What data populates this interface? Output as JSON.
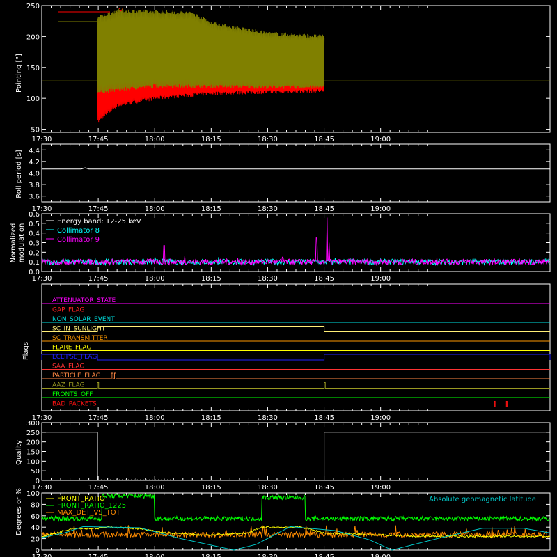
{
  "colors": {
    "background": "#000000",
    "axes": "#ffffff",
    "x_pointing": "#ff0000",
    "y_pointing": "#808000",
    "collimator_8": "#00ffff",
    "collimator_9": "#ff00ff",
    "front_ratio": "#ffff00",
    "front_ratio_1225": "#00ff00",
    "max_det_vs_tot": "#ff8c00",
    "geomag_latitude": "#00c8c8"
  },
  "chart_data": [
    {
      "type": "line",
      "panel": "pointing",
      "ylabel": "Pointing [\"]",
      "ylim": [
        45,
        250
      ],
      "yticks": [
        50,
        100,
        150,
        200,
        250
      ],
      "xlim": [
        1050,
        1185
      ],
      "xticks": [
        1050,
        1065,
        1080,
        1095,
        1110,
        1125,
        1140
      ],
      "xticklabels": [
        "17:30",
        "17:45",
        "18:00",
        "18:15",
        "18:30",
        "18:45",
        "19:00"
      ],
      "legend": [
        "X",
        "Y"
      ],
      "legend_placement": "top-left",
      "series": [
        {
          "name": "X",
          "baseline": 128,
          "active_range": [
            1064.8,
            1125
          ],
          "envelope_low": [
            [
              1064.8,
              62
            ],
            [
              1070,
              88
            ],
            [
              1080,
              100
            ],
            [
              1095,
              108
            ],
            [
              1110,
              110
            ],
            [
              1125,
              112
            ]
          ],
          "envelope_high": [
            [
              1064.8,
              160
            ],
            [
              1080,
              140
            ],
            [
              1110,
              130
            ],
            [
              1125,
              128
            ]
          ]
        },
        {
          "name": "Y",
          "baseline": 128,
          "active_range": [
            1064.8,
            1125
          ],
          "envelope_low": [
            [
              1064.8,
              110
            ],
            [
              1080,
              120
            ],
            [
              1110,
              118
            ],
            [
              1125,
              118
            ]
          ],
          "envelope_high": [
            [
              1064.8,
              230
            ],
            [
              1070,
              242
            ],
            [
              1080,
              240
            ],
            [
              1090,
              238
            ],
            [
              1095,
              222
            ],
            [
              1110,
              205
            ],
            [
              1125,
              200
            ]
          ]
        }
      ]
    },
    {
      "type": "line",
      "panel": "roll",
      "ylabel": "Roll period [s]",
      "ylim": [
        3.5,
        4.5
      ],
      "yticks": [
        3.6,
        3.8,
        4.0,
        4.2,
        4.4
      ],
      "yticklabels": [
        "3.6",
        "3.8",
        "4.0",
        "4.2",
        "4.4"
      ],
      "x": [
        1050,
        1060.5,
        1061.5,
        1062.5,
        1185
      ],
      "values": [
        4.07,
        4.07,
        4.09,
        4.07,
        4.07
      ]
    },
    {
      "type": "line",
      "panel": "modulation",
      "ylabel": "Normalized modulation",
      "ylabel_lines": [
        "Normalized",
        "modulation"
      ],
      "ylim": [
        0,
        0.6
      ],
      "yticks": [
        0.0,
        0.1,
        0.2,
        0.3,
        0.4,
        0.5,
        0.6
      ],
      "yticklabels": [
        "0.0",
        "0.1",
        "0.2",
        "0.3",
        "0.4",
        "0.5",
        "0.6"
      ],
      "legend_title": "Energy band: 12-25 keV",
      "legend": [
        "Collimator 8",
        "Collimator 9"
      ],
      "series": [
        {
          "name": "Collimator 8",
          "level": 0.1,
          "spikes": [
            [
              1082.5,
              0.27
            ],
            [
              1088,
              0.16
            ],
            [
              1102,
              0.14
            ],
            [
              1114,
              0.15
            ],
            [
              1123,
              0.35
            ],
            [
              1125.8,
              0.56
            ],
            [
              1126.3,
              0.3
            ],
            [
              1155,
              0.14
            ]
          ]
        },
        {
          "name": "Collimator 9",
          "level": 0.1,
          "spikes": [
            [
              1080,
              0.15
            ],
            [
              1097,
              0.15
            ],
            [
              1128,
              0.14
            ]
          ]
        }
      ]
    },
    {
      "type": "line",
      "panel": "flags",
      "ylabel": "Flags",
      "flags": [
        {
          "name": "ATTENUATOR_STATE",
          "color": "#ff00ff",
          "segments": []
        },
        {
          "name": "GAP_FLAG",
          "color": "#ff2222",
          "segments": []
        },
        {
          "name": "NON_SOLAR_EVENT",
          "color": "#00e0e0",
          "segments": []
        },
        {
          "name": "SC_IN_SUNLIGHT",
          "color": "#ffee77",
          "segments": [
            [
              1064.8,
              1125
            ]
          ]
        },
        {
          "name": "SC_TRANSMITTER",
          "color": "#ff9900",
          "segments": []
        },
        {
          "name": "FLARE_FLAG",
          "color": "#ffff00",
          "segments": []
        },
        {
          "name": "ECLIPSE_FLAG",
          "color": "#2222ff",
          "segments": [
            [
              1050,
              1064.8
            ],
            [
              1125,
              1185
            ]
          ]
        },
        {
          "name": "SAA_FLAG",
          "color": "#ff3333",
          "segments": []
        },
        {
          "name": "PARTICLE_FLAG",
          "color": "#ff8844",
          "segments": [
            [
              1068.5,
              1068.9
            ],
            [
              1069.3,
              1069.7
            ]
          ]
        },
        {
          "name": "AAZ_FLAG",
          "color": "#999922",
          "segments": [
            [
              1064.8,
              1065.1
            ],
            [
              1125,
              1125.3
            ]
          ]
        },
        {
          "name": "FRONTS_OFF",
          "color": "#00ff00",
          "segments": []
        },
        {
          "name": "BAD_PACKETS",
          "color": "#ff1111",
          "segments": [
            [
              1170.2,
              1170.4
            ],
            [
              1173.4,
              1173.6
            ]
          ]
        }
      ]
    },
    {
      "type": "line",
      "panel": "quality",
      "ylabel": "Quality",
      "ylim": [
        0,
        300
      ],
      "yticks": [
        0,
        50,
        100,
        150,
        200,
        250,
        300
      ],
      "x": [
        1050,
        1064.8,
        1064.8,
        1125,
        1125,
        1185
      ],
      "values": [
        250,
        250,
        0,
        0,
        250,
        250
      ],
      "bumps_range": [
        1065,
        1085
      ],
      "bump_value": 5
    },
    {
      "type": "line",
      "panel": "ratios",
      "ylabel": "Degrees or %",
      "ylim": [
        0,
        100
      ],
      "yticks": [
        0,
        20,
        40,
        60,
        80,
        100
      ],
      "legend": [
        "FRONT_RATIO",
        "FRONT_RATIO_1225",
        "MAX_DET_VS_TOT"
      ],
      "annotation": "Absolute geomagnetic latitude",
      "series": [
        {
          "name": "FRONT_RATIO",
          "steps": [
            [
              1050,
              24
            ],
            [
              1054,
              30
            ],
            [
              1058,
              38
            ],
            [
              1064.8,
              38
            ],
            [
              1068,
              40
            ],
            [
              1075,
              38
            ],
            [
              1083,
              30
            ],
            [
              1094,
              26
            ],
            [
              1105,
              30
            ],
            [
              1108.5,
              40
            ],
            [
              1119,
              40
            ],
            [
              1125,
              30
            ],
            [
              1150,
              24
            ],
            [
              1185,
              24
            ]
          ]
        },
        {
          "name": "FRONT_RATIO_1225",
          "steps": [
            [
              1050,
              55
            ],
            [
              1064.8,
              55
            ],
            [
              1066,
              95
            ],
            [
              1079,
              95
            ],
            [
              1080,
              55
            ],
            [
              1100,
              55
            ],
            [
              1108.5,
              92
            ],
            [
              1119,
              92
            ],
            [
              1120,
              55
            ],
            [
              1185,
              55
            ]
          ]
        },
        {
          "name": "MAX_DET_VS_TOT",
          "level": 27
        },
        {
          "name": "Absolute geomagnetic latitude",
          "x": [
            1050,
            1056,
            1061,
            1076,
            1087,
            1101,
            1107,
            1116,
            1128,
            1137,
            1143,
            1155,
            1167,
            1178,
            1185
          ],
          "values": [
            22,
            30,
            41,
            39,
            20,
            0,
            10,
            41,
            34,
            18,
            0,
            20,
            38,
            38,
            30
          ]
        }
      ]
    }
  ]
}
